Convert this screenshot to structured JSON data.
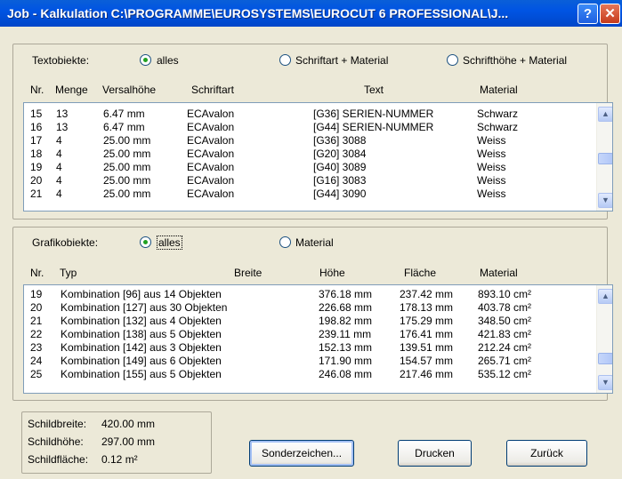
{
  "window": {
    "title": "Job - Kalkulation  C:\\PROGRAMME\\EUROSYSTEMS\\EUROCUT 6 PROFESSIONAL\\J...",
    "help": "?",
    "close": "✕"
  },
  "text": {
    "filter_label": "Textobiekte:",
    "options": [
      "alles",
      "Schriftart + Material",
      "Schrifthöhe + Material"
    ],
    "selected": 0,
    "headers": [
      "Nr.",
      "Menge",
      "Versalhöhe",
      "Schriftart",
      "Text",
      "Material"
    ],
    "rows": [
      [
        "15",
        "13",
        "6.47 mm",
        "ECAvalon",
        "[G36] SERIEN-NUMMER",
        "Schwarz"
      ],
      [
        "16",
        "13",
        "6.47 mm",
        "ECAvalon",
        "[G44] SERIEN-NUMMER",
        "Schwarz"
      ],
      [
        "17",
        "4",
        "25.00 mm",
        "ECAvalon",
        "[G36] 3088",
        "Weiss"
      ],
      [
        "18",
        "4",
        "25.00 mm",
        "ECAvalon",
        "[G20] 3084",
        "Weiss"
      ],
      [
        "19",
        "4",
        "25.00 mm",
        "ECAvalon",
        "[G40] 3089",
        "Weiss"
      ],
      [
        "20",
        "4",
        "25.00 mm",
        "ECAvalon",
        "[G16] 3083",
        "Weiss"
      ],
      [
        "21",
        "4",
        "25.00 mm",
        "ECAvalon",
        "[G44] 3090",
        "Weiss"
      ]
    ]
  },
  "graphics": {
    "filter_label": "Grafikobiekte:",
    "options": [
      "alles",
      "Material"
    ],
    "selected": 0,
    "headers": [
      "Nr.",
      "Typ",
      "Breite",
      "Höhe",
      "Fläche",
      "Material"
    ],
    "rows": [
      [
        "19",
        "Kombination [96] aus 14 Objekten",
        "376.18 mm",
        "237.42 mm",
        "893.10 cm²"
      ],
      [
        "20",
        "Kombination [127] aus 30 Objekten",
        "226.68 mm",
        "178.13 mm",
        "403.78 cm²"
      ],
      [
        "21",
        "Kombination [132] aus 4 Objekten",
        "198.82 mm",
        "175.29 mm",
        "348.50 cm²"
      ],
      [
        "22",
        "Kombination [138] aus 5 Objekten",
        "239.11 mm",
        "176.41 mm",
        "421.83 cm²"
      ],
      [
        "23",
        "Kombination [142] aus 3 Objekten",
        "152.13 mm",
        "139.51 mm",
        "212.24 cm²"
      ],
      [
        "24",
        "Kombination [149] aus 6 Objekten",
        "171.90 mm",
        "154.57 mm",
        "265.71 cm²"
      ],
      [
        "25",
        "Kombination [155] aus 5 Objekten",
        "246.08 mm",
        "217.46 mm",
        "535.12 cm²"
      ]
    ]
  },
  "info": {
    "labels": [
      "Schildbreite:",
      "Schildhöhe:",
      "Schildfläche:"
    ],
    "values": [
      "420.00 mm",
      "297.00 mm",
      "0.12 m²"
    ]
  },
  "buttons": {
    "special": "Sonderzeichen...",
    "print": "Drucken",
    "back": "Zurück"
  },
  "icons": {
    "scroll_up": "▲",
    "scroll_down": "▼"
  }
}
